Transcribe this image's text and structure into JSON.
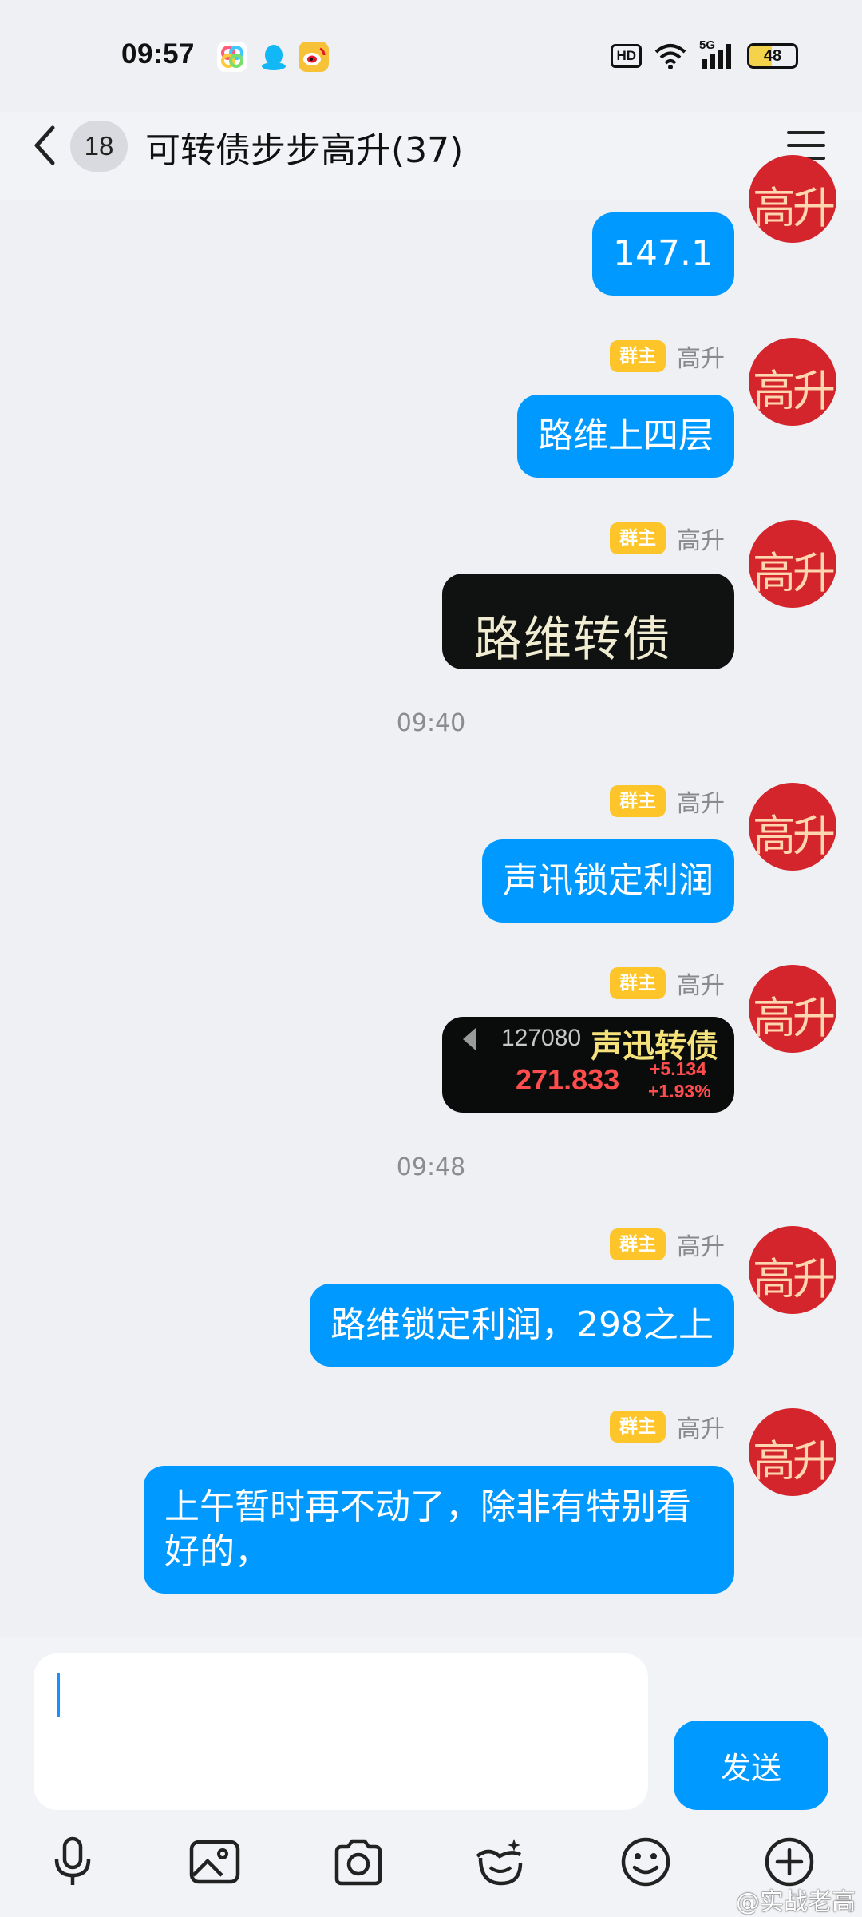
{
  "status_bar": {
    "time": "09:57",
    "indicators": [
      "HD",
      "5G"
    ],
    "battery": 48,
    "app_icons": [
      "photos-icon",
      "qq-icon",
      "weibo-icon"
    ]
  },
  "header": {
    "unread_count": "18",
    "title": "可转债步步高升(37)"
  },
  "avatar_text": "高升",
  "messages": [
    {
      "type": "text",
      "text": "147.1"
    },
    {
      "type": "text",
      "role": "群主",
      "sender": "高升",
      "text": "路维上四层"
    },
    {
      "type": "image",
      "role": "群主",
      "sender": "高升",
      "image_text": "路维转债"
    },
    {
      "type": "time",
      "text": "09:40"
    },
    {
      "type": "text",
      "role": "群主",
      "sender": "高升",
      "text": "声讯锁定利润"
    },
    {
      "type": "image",
      "role": "群主",
      "sender": "高升",
      "quote": {
        "code": "127080",
        "name": "声迅转债",
        "price": "271.833",
        "change": "+5.134",
        "pct": "+1.93%"
      }
    },
    {
      "type": "time",
      "text": "09:48"
    },
    {
      "type": "text",
      "role": "群主",
      "sender": "高升",
      "text": "路维锁定利润，298之上"
    },
    {
      "type": "text",
      "role": "群主",
      "sender": "高升",
      "text": "上午暂时再不动了，除非有特别看好的，"
    }
  ],
  "input": {
    "value": "",
    "send_label": "发送"
  },
  "toolbar": [
    "microphone-icon",
    "image-icon",
    "camera-icon",
    "sticker-face-icon",
    "emoji-icon",
    "plus-icon"
  ],
  "watermark": "@实战老高",
  "colors": {
    "bubble": "#0099ff",
    "badge": "#fdc52a",
    "avatar": "#d4252c",
    "background": "#eff0f4"
  }
}
